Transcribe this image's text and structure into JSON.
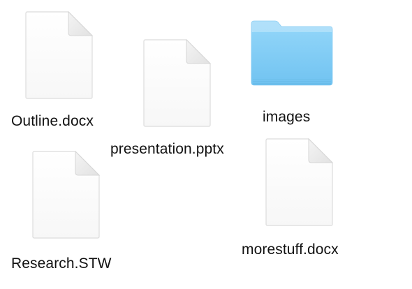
{
  "desktop": {
    "items": [
      {
        "name": "Outline.docx",
        "icon": "document-icon"
      },
      {
        "name": "presentation.pptx",
        "icon": "document-icon"
      },
      {
        "name": "images",
        "icon": "folder-icon"
      },
      {
        "name": "Research.STW",
        "icon": "document-icon"
      },
      {
        "name": "morestuff.docx",
        "icon": "document-icon"
      }
    ]
  },
  "colors": {
    "background": "#ffffff",
    "document_page": "#ffffff",
    "document_border": "#dcdcdc",
    "folder_front": "#7ecbf5",
    "folder_back": "#a8dcf8",
    "label_text": "#111111"
  }
}
